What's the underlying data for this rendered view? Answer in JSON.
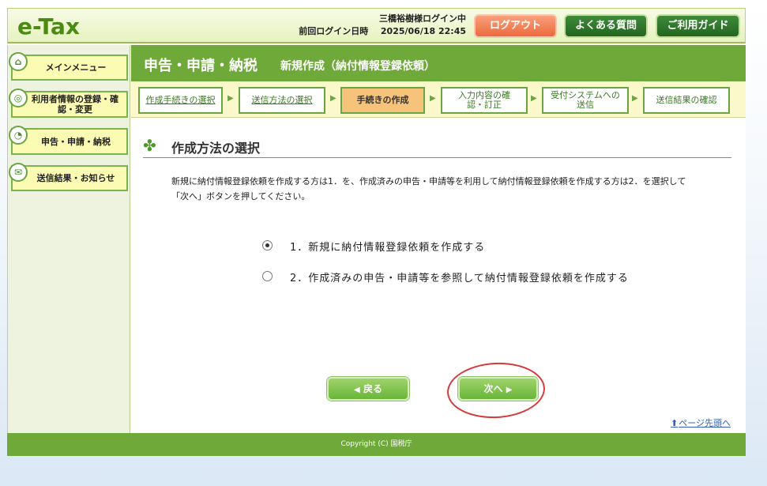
{
  "header": {
    "logo": "e-Tax",
    "user_status": "三橋裕樹様ログイン中",
    "last_login_label": "前回ログイン日時",
    "last_login_value": "2025/06/18 22:45",
    "logout_label": "ログアウト",
    "faq_label": "よくある質問",
    "guide_label": "ご利用ガイド"
  },
  "sidebar": {
    "items": [
      {
        "label": "メインメニュー",
        "icon": "home-icon"
      },
      {
        "label": "利用者情報の登録・確認・変更",
        "icon": "user-info-icon"
      },
      {
        "label": "申告・申請・納税",
        "icon": "declaration-icon"
      },
      {
        "label": "送信結果・お知らせ",
        "icon": "notification-icon"
      }
    ]
  },
  "title": {
    "main": "申告・申請・納税",
    "sub": "新規作成（納付情報登録依頼）"
  },
  "steps": [
    {
      "label": "作成手続きの選択",
      "state": "done"
    },
    {
      "label": "送信方法の選択",
      "state": "done"
    },
    {
      "label": "手続きの作成",
      "state": "current"
    },
    {
      "label": "入力内容の確認・訂正",
      "state": "todo"
    },
    {
      "label": "受付システムへの送信",
      "state": "todo"
    },
    {
      "label": "送信結果の確認",
      "state": "todo"
    }
  ],
  "section": {
    "title": "作成方法の選択",
    "description": "新規に納付情報登録依頼を作成する方は1．を、作成済みの申告・申請等を利用して納付情報登録依頼を作成する方は2．を選択して「次へ」ボタンを押してください。"
  },
  "options": [
    {
      "label": "1．新規に納付情報登録依頼を作成する",
      "selected": true
    },
    {
      "label": "2．作成済みの申告・申請等を参照して納付情報登録依頼を作成する",
      "selected": false
    }
  ],
  "buttons": {
    "back_label": "戻る",
    "next_label": "次へ"
  },
  "page_top_label": "ページ先頭へ",
  "footer": {
    "copyright": "Copyright (C) 国税庁"
  },
  "colors": {
    "brand_green": "#6fa93a",
    "logout_orange": "#ec6a3c",
    "annotation_red": "#d53a3a"
  }
}
